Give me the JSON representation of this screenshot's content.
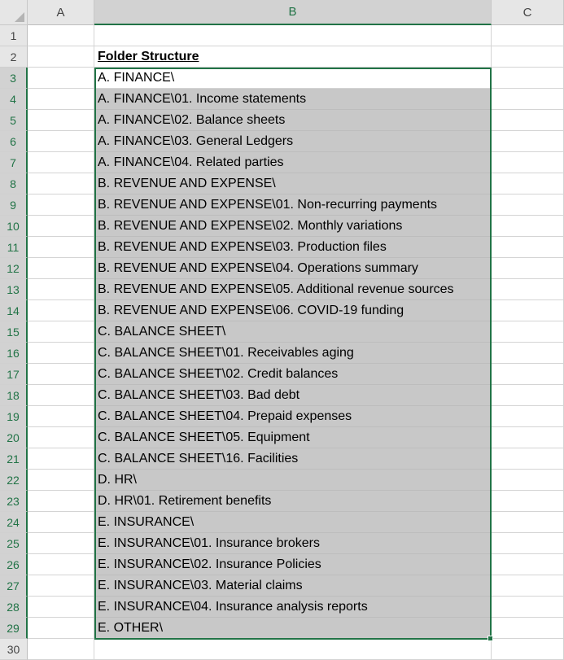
{
  "columns": [
    "A",
    "B",
    "C"
  ],
  "row_numbers": [
    "1",
    "2",
    "3",
    "4",
    "5",
    "6",
    "7",
    "8",
    "9",
    "10",
    "11",
    "12",
    "13",
    "14",
    "15",
    "16",
    "17",
    "18",
    "19",
    "20",
    "21",
    "22",
    "23",
    "24",
    "25",
    "26",
    "27",
    "28",
    "29",
    "30"
  ],
  "title_cell": "Folder Structure",
  "folders": [
    "A. FINANCE\\",
    "A. FINANCE\\01. Income statements",
    "A. FINANCE\\02. Balance sheets",
    "A. FINANCE\\03. General Ledgers",
    "A. FINANCE\\04. Related parties",
    "B. REVENUE AND EXPENSE\\",
    "B. REVENUE AND EXPENSE\\01. Non-recurring payments",
    "B. REVENUE AND EXPENSE\\02. Monthly variations",
    "B. REVENUE AND EXPENSE\\03. Production files",
    "B. REVENUE AND EXPENSE\\04. Operations summary",
    "B. REVENUE AND EXPENSE\\05. Additional revenue sources",
    "B. REVENUE AND EXPENSE\\06. COVID-19 funding",
    "C. BALANCE SHEET\\",
    "C. BALANCE SHEET\\01. Receivables aging",
    "C. BALANCE SHEET\\02. Credit balances",
    "C. BALANCE SHEET\\03. Bad debt",
    "C. BALANCE SHEET\\04. Prepaid expenses",
    "C. BALANCE SHEET\\05. Equipment",
    "C. BALANCE SHEET\\16. Facilities",
    "D. HR\\",
    "D. HR\\01. Retirement benefits",
    "E. INSURANCE\\",
    "E. INSURANCE\\01. Insurance brokers",
    "E. INSURANCE\\02. Insurance Policies",
    "E. INSURANCE\\03. Material claims",
    "E. INSURANCE\\04. Insurance analysis reports",
    "E. OTHER\\"
  ],
  "colors": {
    "selection": "#217346",
    "fill": "#c8c8c8",
    "header": "#e6e6e6"
  }
}
